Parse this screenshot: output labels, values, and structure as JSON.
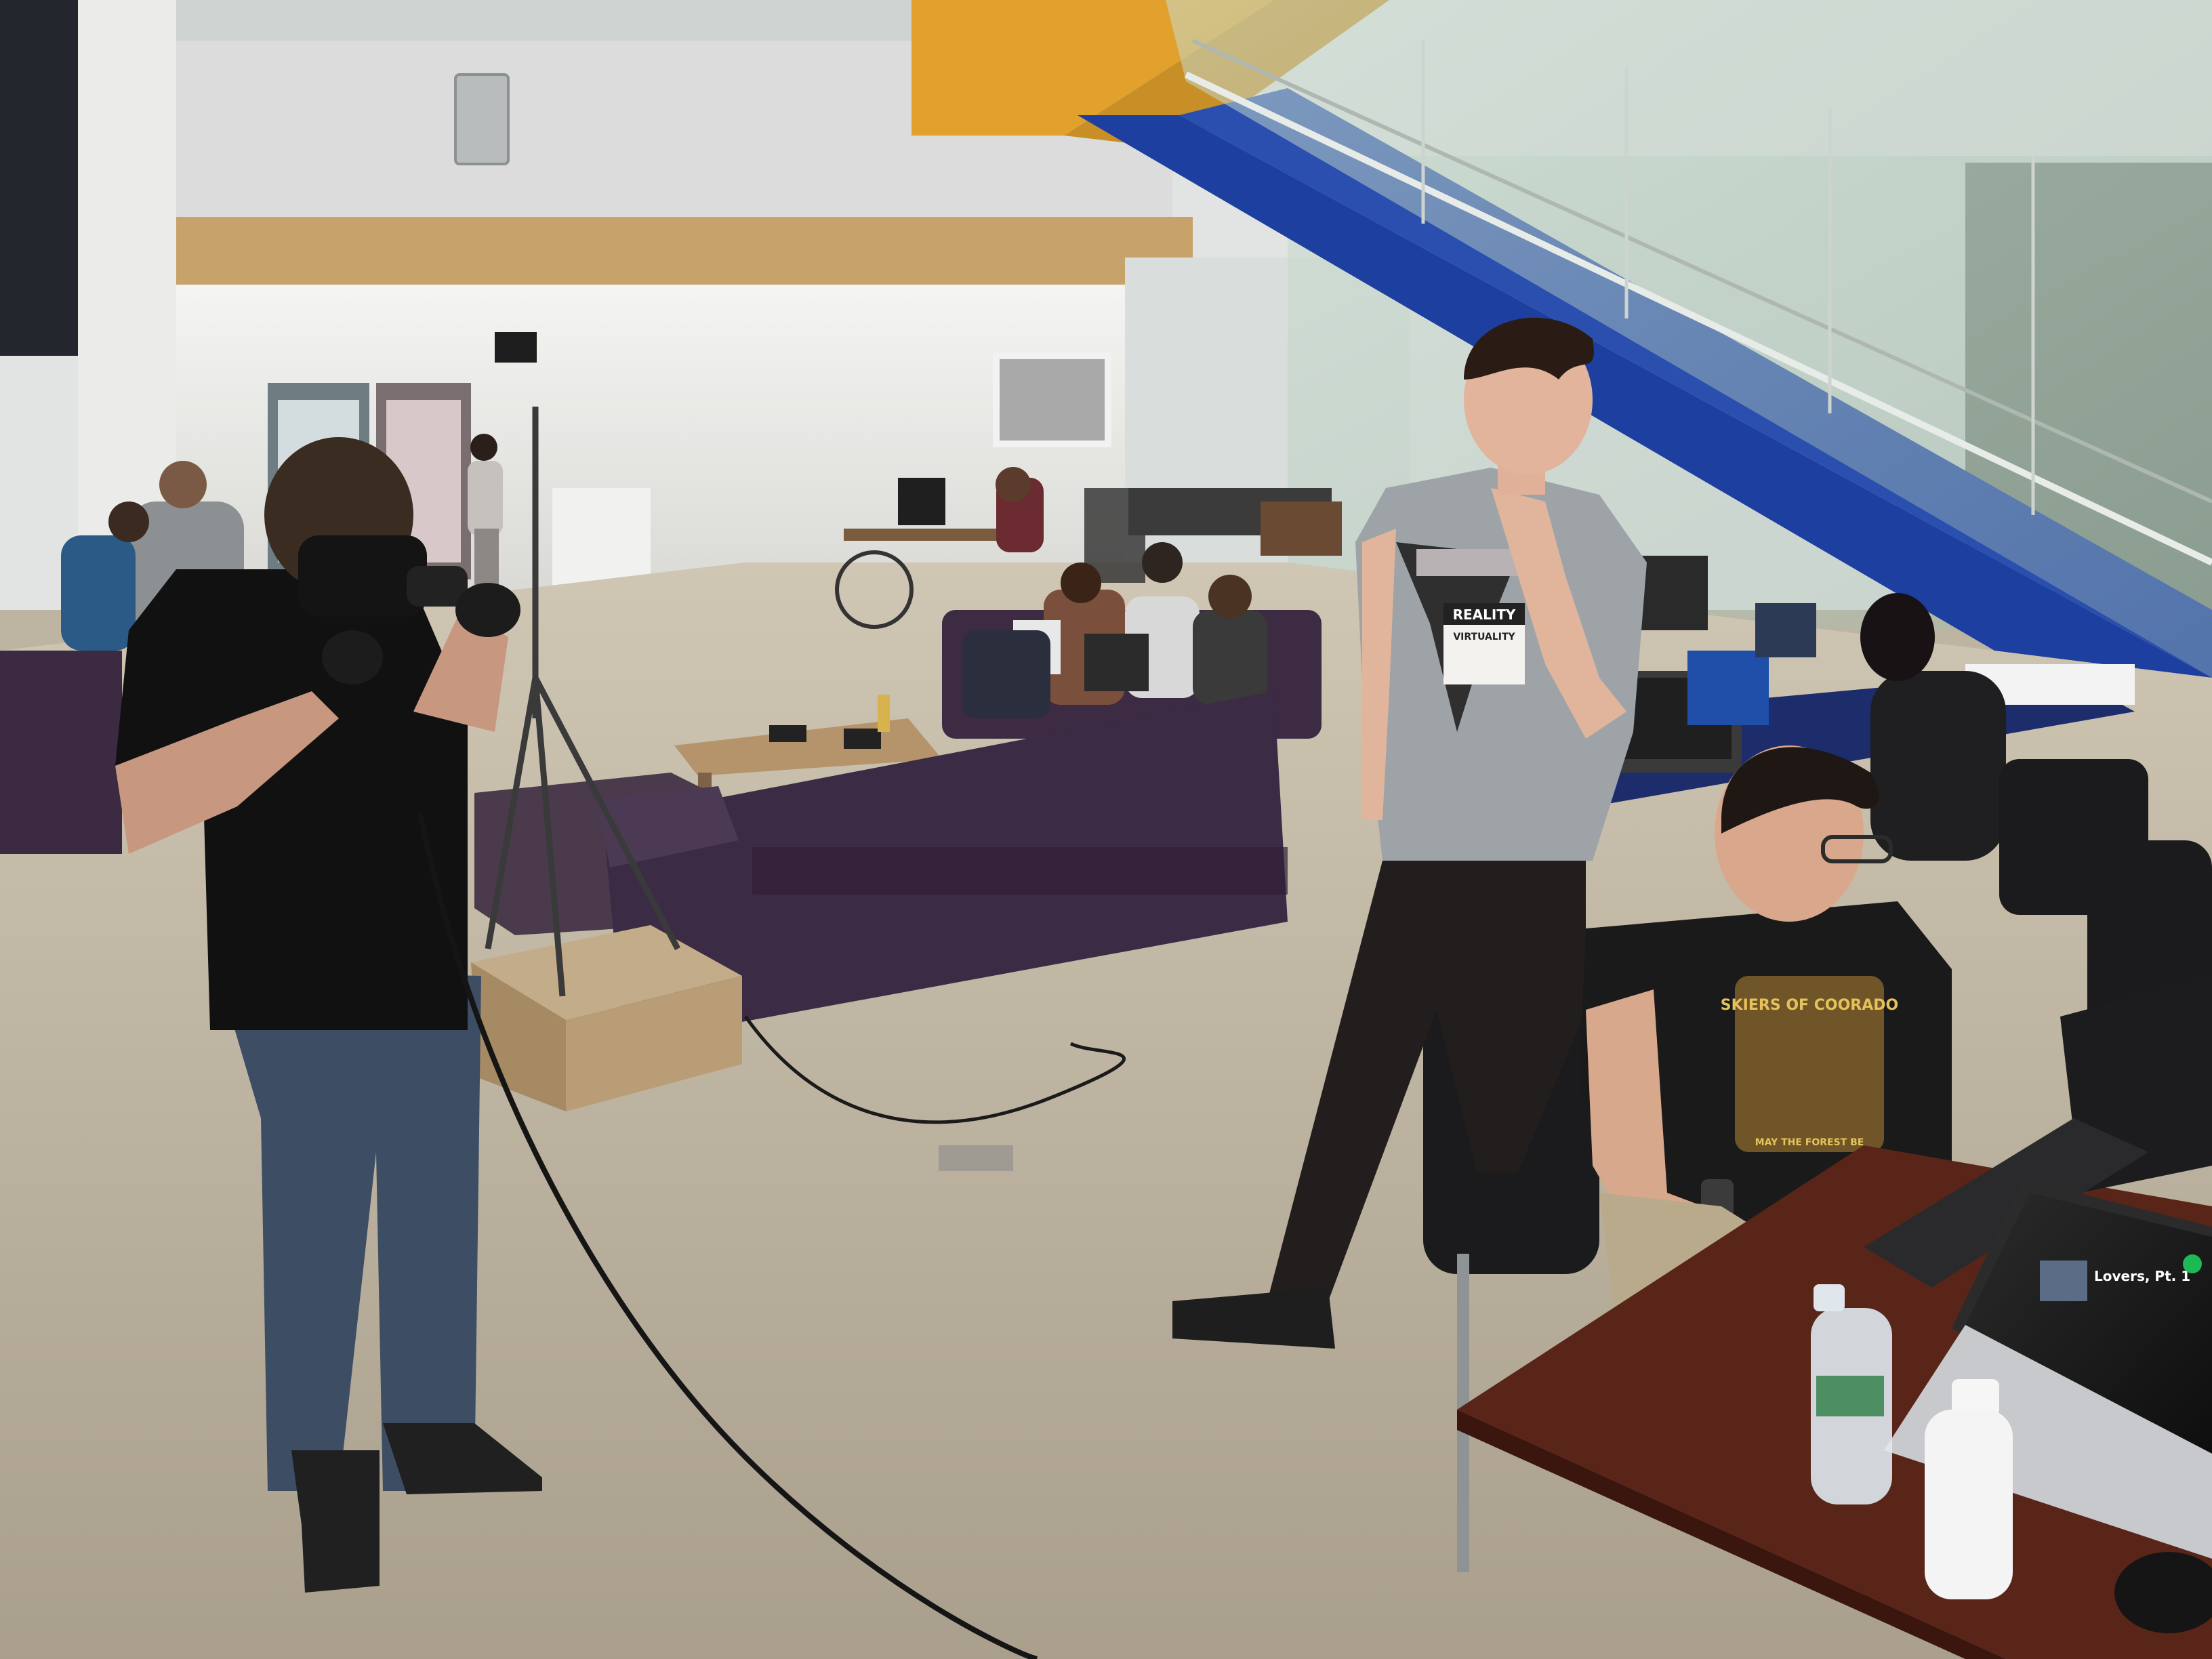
{
  "photo": {
    "subject": "hackathon-vr-demo",
    "badge_line1": "REALITY",
    "badge_line2": "VIRTUALITY",
    "shirt_text": "SKIERS OF COORADO",
    "shirt_subtext": "MAY THE FOREST BE",
    "laptop_track": "Lovers, Pt. 1",
    "box_brand": "",
    "colors": {
      "carpet": "#bcb3a1",
      "wall": "#e4e4e2",
      "stair_blue": "#1c3f9e",
      "stair_yellow": "#e0a12a",
      "sofa": "#3e2b45",
      "shirt_grey": "#9ea3a8",
      "spotify_green": "#1db954"
    }
  }
}
